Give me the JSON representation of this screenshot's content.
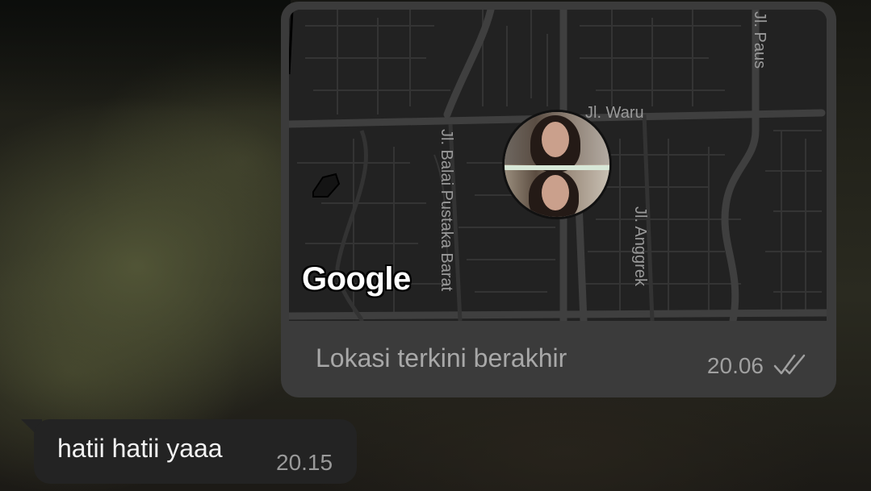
{
  "map": {
    "provider_logo": "Google",
    "street_labels": {
      "paus": "Jl. Paus",
      "waru": "Jl. Waru",
      "balai_pustaka": "Jl. Balai Pustaka Barat",
      "anggrek": "Jl. Anggrek"
    },
    "theme": "dark"
  },
  "location_message": {
    "caption": "Lokasi terkini berakhir",
    "time": "20.06",
    "status_icon": "double-check-icon",
    "bubble_color": "#3b3b3b"
  },
  "incoming_message": {
    "text": "hatii hatii yaaa",
    "time": "20.15",
    "bubble_color": "#232323"
  },
  "colors": {
    "map_background": "#222222",
    "map_roads": "#3e3e3e",
    "map_blocks": "#333333",
    "label_text": "#9a9a9a"
  }
}
